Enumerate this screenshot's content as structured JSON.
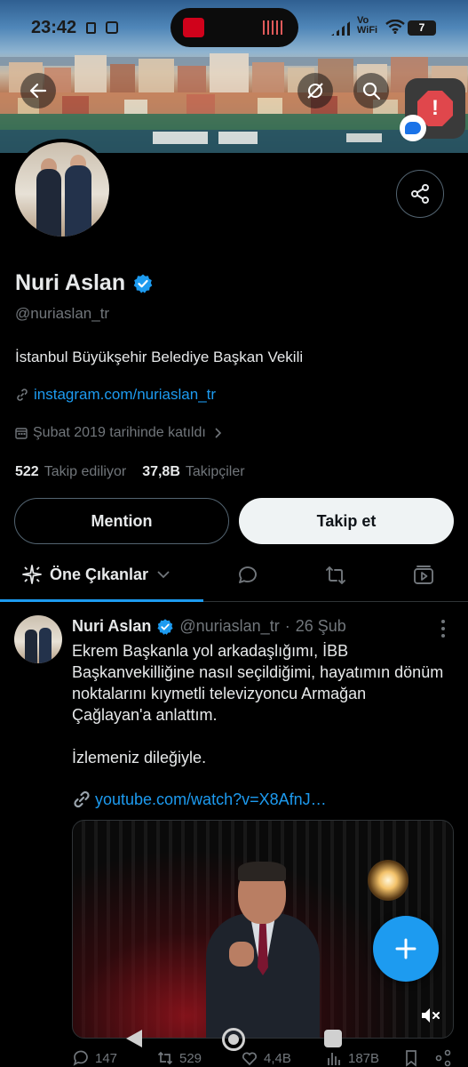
{
  "status_bar": {
    "time": "23:42",
    "network_label": "Vo WiFi",
    "battery": "7"
  },
  "header": {
    "back_icon": "arrow-left-icon",
    "hide_icon": "eye-off-icon",
    "search_icon": "search-icon"
  },
  "profile": {
    "name": "Nuri Aslan",
    "handle": "@nuriaslan_tr",
    "bio": "İstanbul Büyükşehir Belediye Başkan Vekili",
    "link": "instagram.com/nuriaslan_tr",
    "joined": "Şubat 2019 tarihinde katıldı",
    "following_count": "522",
    "following_label": "Takip ediliyor",
    "followers_count": "37,8B",
    "followers_label": "Takipçiler",
    "verified_color": "#1d9bf0"
  },
  "buttons": {
    "mention": "Mention",
    "follow": "Takip et"
  },
  "tabs": {
    "active_label": "Öne Çıkanlar"
  },
  "tweet": {
    "name": "Nuri Aslan",
    "handle": "@nuriaslan_tr",
    "sep": "·",
    "date": "26 Şub",
    "text_p1": "Ekrem Başkanla yol arkadaşlığımı, İBB Başkanvekilliğine nasıl seçildiğimi, hayatımın dönüm noktalarını kıymetli televizyoncu Armağan Çağlayan'a anlattım.",
    "text_p2": "İzlemeniz dileğiyle.",
    "link": "youtube.com/watch?v=X8AfnJ…",
    "replies": "147",
    "retweets": "529",
    "likes": "4,4B",
    "views": "187B"
  },
  "colors": {
    "accent": "#1d9bf0",
    "background": "#000000",
    "muted": "#71767b"
  }
}
